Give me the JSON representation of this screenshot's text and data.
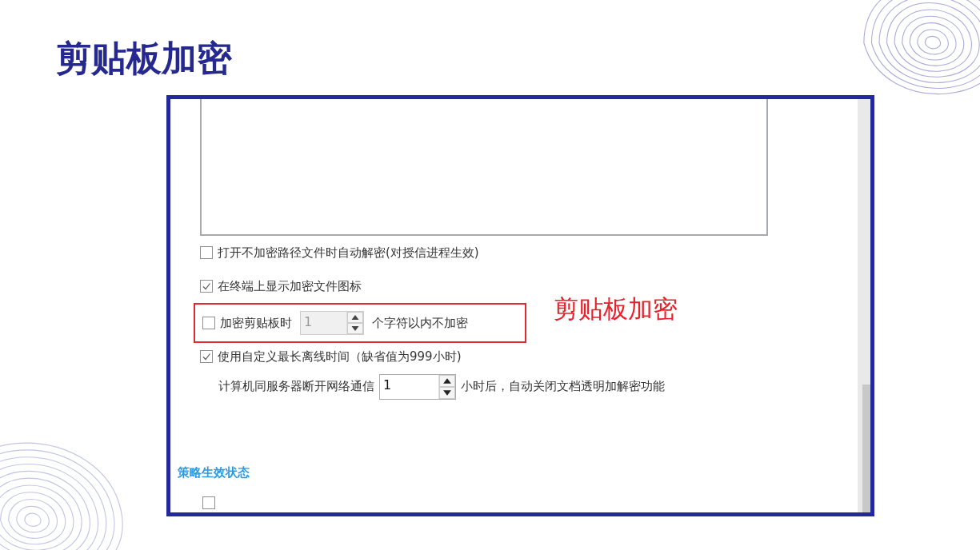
{
  "slide_title": "剪贴板加密",
  "screenshot": {
    "options": [
      {
        "kind": "checkbox",
        "label": "打开不加密路径文件时自动解密(对授信进程生效)",
        "checked": false
      },
      {
        "kind": "checkbox",
        "label": "在终端上显示加密文件图标",
        "checked": true
      },
      {
        "kind": "spin",
        "label": "加密剪贴板时",
        "checked": false,
        "value": "1",
        "disabled": true,
        "suffix": "个字符以内不加密",
        "highlighted": true
      },
      {
        "kind": "checkbox",
        "label": "使用自定义最长离线时间（缺省值为999小时)",
        "checked": true
      },
      {
        "kind": "indented-spin",
        "label": "计算机同服务器断开网络通信",
        "value": "1",
        "disabled": false,
        "suffix": "小时后，自动关闭文档透明加解密功能"
      }
    ],
    "section_heading": "策略生效状态",
    "section_items": [
      {
        "kind": "checkbox",
        "checked": false
      }
    ]
  },
  "annotation": "剪贴板加密"
}
